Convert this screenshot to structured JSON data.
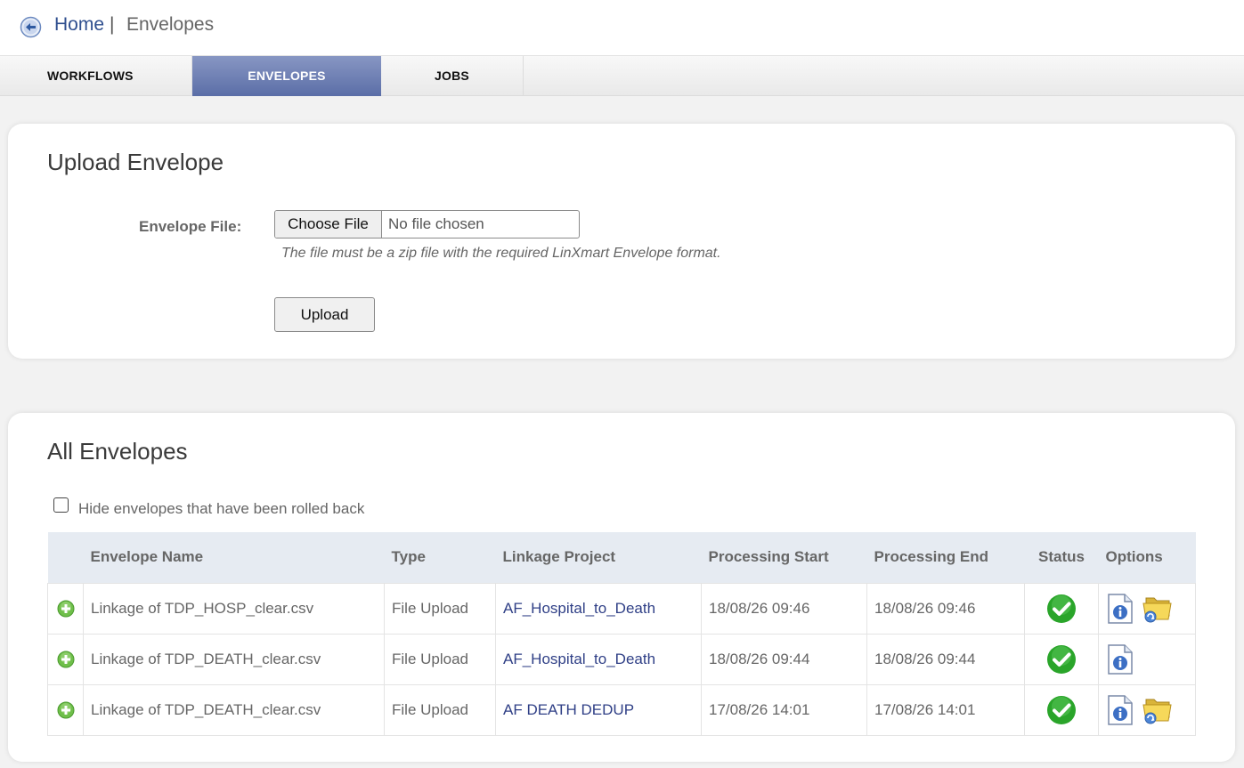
{
  "breadcrumb": {
    "home": "Home",
    "separator": "|",
    "current": "Envelopes"
  },
  "tabs": [
    {
      "label": "WORKFLOWS",
      "active": false
    },
    {
      "label": "ENVELOPES",
      "active": true
    },
    {
      "label": "JOBS",
      "active": false
    }
  ],
  "upload": {
    "title": "Upload Envelope",
    "file_label": "Envelope File:",
    "choose_label": "Choose File",
    "file_value": "No file chosen",
    "hint": "The file must be a zip file with the required LinXmart Envelope format.",
    "upload_label": "Upload"
  },
  "list": {
    "title": "All Envelopes",
    "filter_label": "Hide envelopes that have been rolled back",
    "filter_checked": false,
    "columns": [
      "Envelope Name",
      "Type",
      "Linkage Project",
      "Processing Start",
      "Processing End",
      "Status",
      "Options"
    ],
    "rows": [
      {
        "name": "Linkage of TDP_HOSP_clear.csv",
        "type": "File Upload",
        "project": "AF_Hospital_to_Death",
        "start": "18/08/26 09:46",
        "end": "18/08/26 09:46",
        "status": "success",
        "has_folder": true
      },
      {
        "name": "Linkage of TDP_DEATH_clear.csv",
        "type": "File Upload",
        "project": "AF_Hospital_to_Death",
        "start": "18/08/26 09:44",
        "end": "18/08/26 09:44",
        "status": "success",
        "has_folder": false
      },
      {
        "name": "Linkage of TDP_DEATH_clear.csv",
        "type": "File Upload",
        "project": "AF DEATH DEDUP",
        "start": "17/08/26 14:01",
        "end": "17/08/26 14:01",
        "status": "success",
        "has_folder": true
      }
    ]
  },
  "colors": {
    "link": "#2f3f86",
    "tab_active": "#6b7db3",
    "success": "#2aa52a"
  }
}
